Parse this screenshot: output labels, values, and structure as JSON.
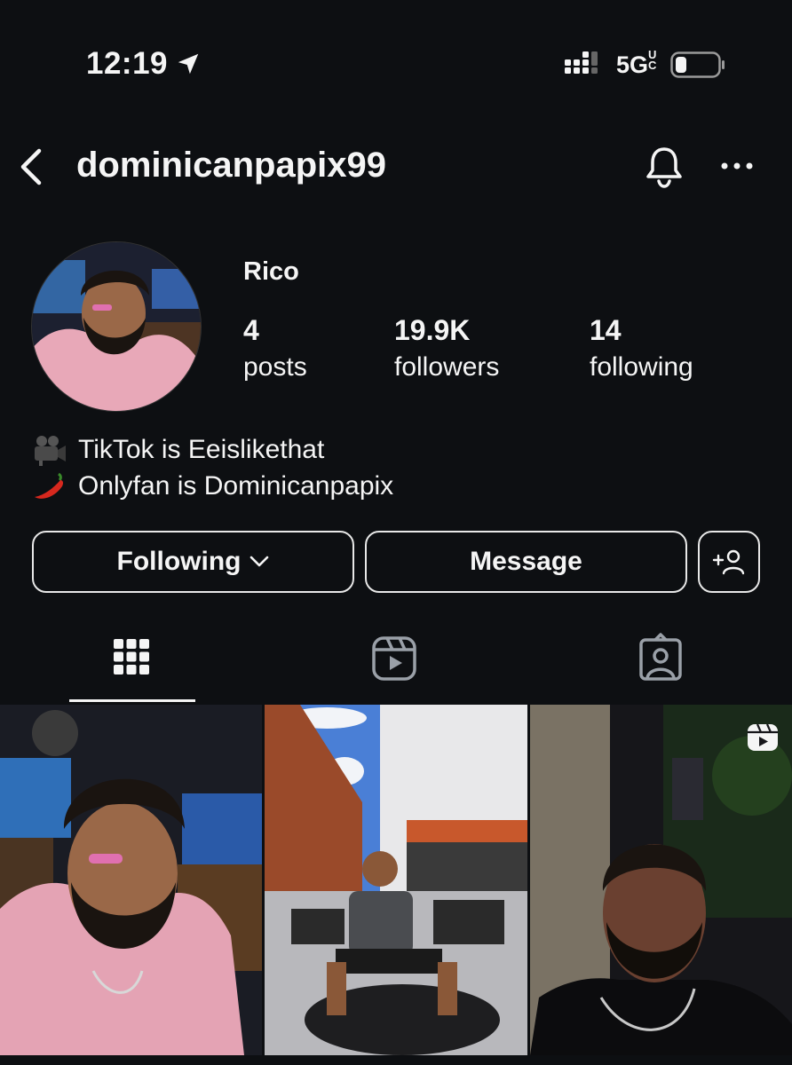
{
  "status_bar": {
    "time": "12:19",
    "network": "5G",
    "network_suffix": "UC"
  },
  "header": {
    "username": "dominicanpapix99"
  },
  "profile": {
    "display_name": "Rico",
    "stats": [
      {
        "value": "4",
        "label": "posts"
      },
      {
        "value": "19.9K",
        "label": "followers"
      },
      {
        "value": "14",
        "label": "following"
      }
    ],
    "bio": [
      {
        "icon": "movie-camera-icon",
        "text": "TikTok is Eeislikethat"
      },
      {
        "icon": "hot-pepper-icon",
        "text": "Onlyfan is Dominicanpapix"
      }
    ]
  },
  "actions": {
    "following_label": "Following",
    "message_label": "Message"
  },
  "tabs": [
    "grid-tab",
    "reels-tab",
    "tagged-tab"
  ],
  "colors": {
    "background": "#0d0f12",
    "text": "#f5f5f5",
    "button_border": "#e8e8e8"
  }
}
